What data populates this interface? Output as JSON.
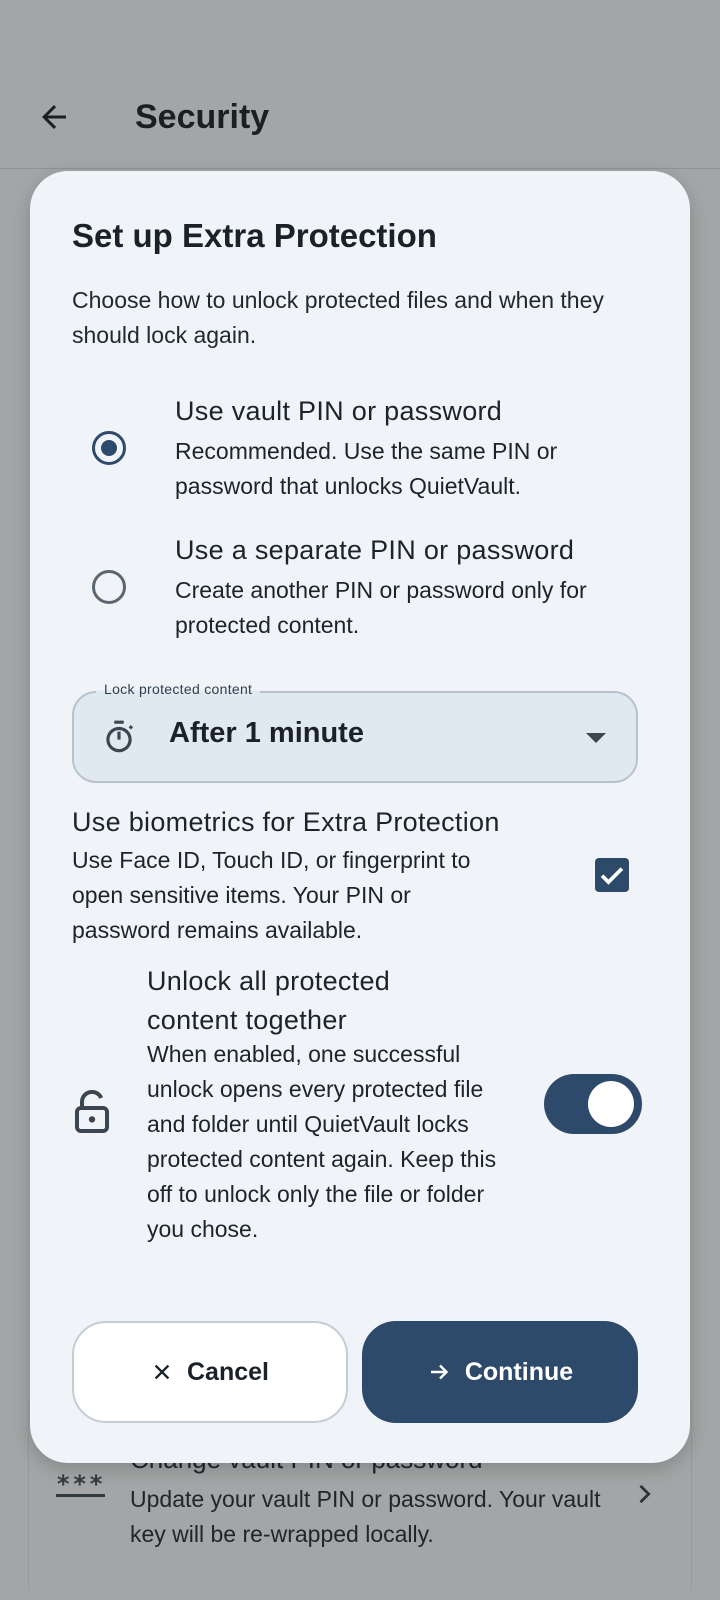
{
  "appbar": {
    "title": "Security"
  },
  "background_row": {
    "title": "Change vault PIN or password",
    "subtitle": "Update your vault PIN or password. Your vault key will be re-wrapped locally.",
    "icon_text": "***"
  },
  "dialog": {
    "title": "Set up Extra Protection",
    "description": "Choose how to unlock protected files and when they should lock again.",
    "options": [
      {
        "title": "Use vault PIN or password",
        "subtitle": "Recommended. Use the same PIN or password that unlocks QuietVault.",
        "selected": true
      },
      {
        "title": "Use a separate PIN or password",
        "subtitle": "Create another PIN or password only for protected content.",
        "selected": false
      }
    ],
    "lock_select": {
      "label": "Lock protected content",
      "value": "After 1 minute"
    },
    "biometrics": {
      "title": "Use biometrics for Extra Protection",
      "subtitle": "Use Face ID, Touch ID, or fingerprint to open sensitive items. Your PIN or password remains available.",
      "checked": true
    },
    "unlock_all": {
      "title": "Unlock all protected content together",
      "subtitle": "When enabled, one successful unlock opens every protected file and folder until QuietVault locks protected content again. Keep this off to unlock only the file or folder you chose.",
      "enabled": true
    },
    "buttons": {
      "cancel": "Cancel",
      "continue": "Continue"
    }
  },
  "colors": {
    "accent": "#2e4a6b",
    "dialog_bg": "#f0f4f8",
    "scrim": "#a3a5a6"
  },
  "icons": {
    "back": "arrow-left-icon",
    "timer": "timer-icon",
    "unlock": "lock-open-icon",
    "check": "check-icon",
    "close": "close-icon",
    "continue": "arrow-right-icon",
    "row": "password-icon",
    "row_chevron": "chevron-right-icon"
  }
}
